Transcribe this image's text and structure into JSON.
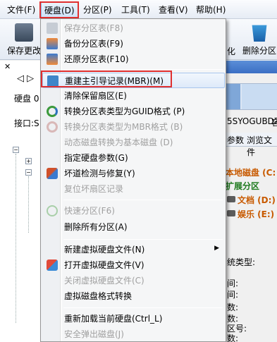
{
  "menubar": {
    "items": [
      "文件(F)",
      "硬盘(D)",
      "分区(P)",
      "工具(T)",
      "查看(V)",
      "帮助(H)"
    ]
  },
  "toolbar": {
    "save_label": "保存更改",
    "convert_label": "化",
    "delete_partition_label": "删除分区"
  },
  "left_panel": {
    "disk_label": "硬盘 0",
    "interface_label": "接口:S"
  },
  "right_panel": {
    "serial": "5SYOGUBDZ",
    "serial_suffix": "容",
    "tab_params": "参数",
    "tab_browse": "浏览文件",
    "local_disk": "本地磁盘 (C:",
    "extended": "扩展分区",
    "doc_partition": "文档 (D:)",
    "ent_partition": "娱乐 (E:)",
    "fs_type": "统类型:",
    "info_rows": [
      "间:",
      "间:",
      "数:",
      "数:",
      "区号:",
      "数:"
    ]
  },
  "dropdown": {
    "items": [
      {
        "label": "保存分区表(F8)",
        "disabled": true,
        "icon": "save-icon"
      },
      {
        "label": "备份分区表(F9)",
        "disabled": false,
        "icon": "backup-icon"
      },
      {
        "label": "还原分区表(F10)",
        "disabled": false,
        "icon": "restore-icon"
      },
      {
        "label": "重建主引导记录(MBR)(M)",
        "disabled": false,
        "icon": "rebuild-mbr-icon",
        "highlighted": true
      },
      {
        "label": "清除保留扇区(E)",
        "disabled": false,
        "icon": ""
      },
      {
        "label": "转换分区表类型为GUID格式 (P)",
        "disabled": false,
        "icon": "convert-guid-icon"
      },
      {
        "label": "转换分区表类型为MBR格式 (B)",
        "disabled": true,
        "icon": "convert-mbr-icon"
      },
      {
        "label": "动态磁盘转换为基本磁盘 (D)",
        "disabled": true,
        "icon": ""
      },
      {
        "label": "指定硬盘参数(G)",
        "disabled": false,
        "icon": ""
      },
      {
        "label": "坏道检测与修复(Y)",
        "disabled": false,
        "icon": "repair-icon"
      },
      {
        "label": "复位坏扇区记录",
        "disabled": true,
        "icon": ""
      },
      {
        "label": "快速分区(F6)",
        "disabled": true,
        "icon": "quick-partition-icon"
      },
      {
        "label": "删除所有分区(A)",
        "disabled": false,
        "icon": ""
      },
      {
        "label": "新建虚拟硬盘文件(N)",
        "disabled": false,
        "icon": "",
        "submenu": true
      },
      {
        "label": "打开虚拟硬盘文件(V)",
        "disabled": false,
        "icon": "open-vdisk-icon"
      },
      {
        "label": "关闭虚拟硬盘文件(C)",
        "disabled": true,
        "icon": ""
      },
      {
        "label": "虚拟磁盘格式转换",
        "disabled": false,
        "icon": ""
      },
      {
        "label": "重新加载当前硬盘(Ctrl_L)",
        "disabled": false,
        "icon": ""
      },
      {
        "label": "安全弹出磁盘(J)",
        "disabled": true,
        "icon": ""
      }
    ]
  }
}
